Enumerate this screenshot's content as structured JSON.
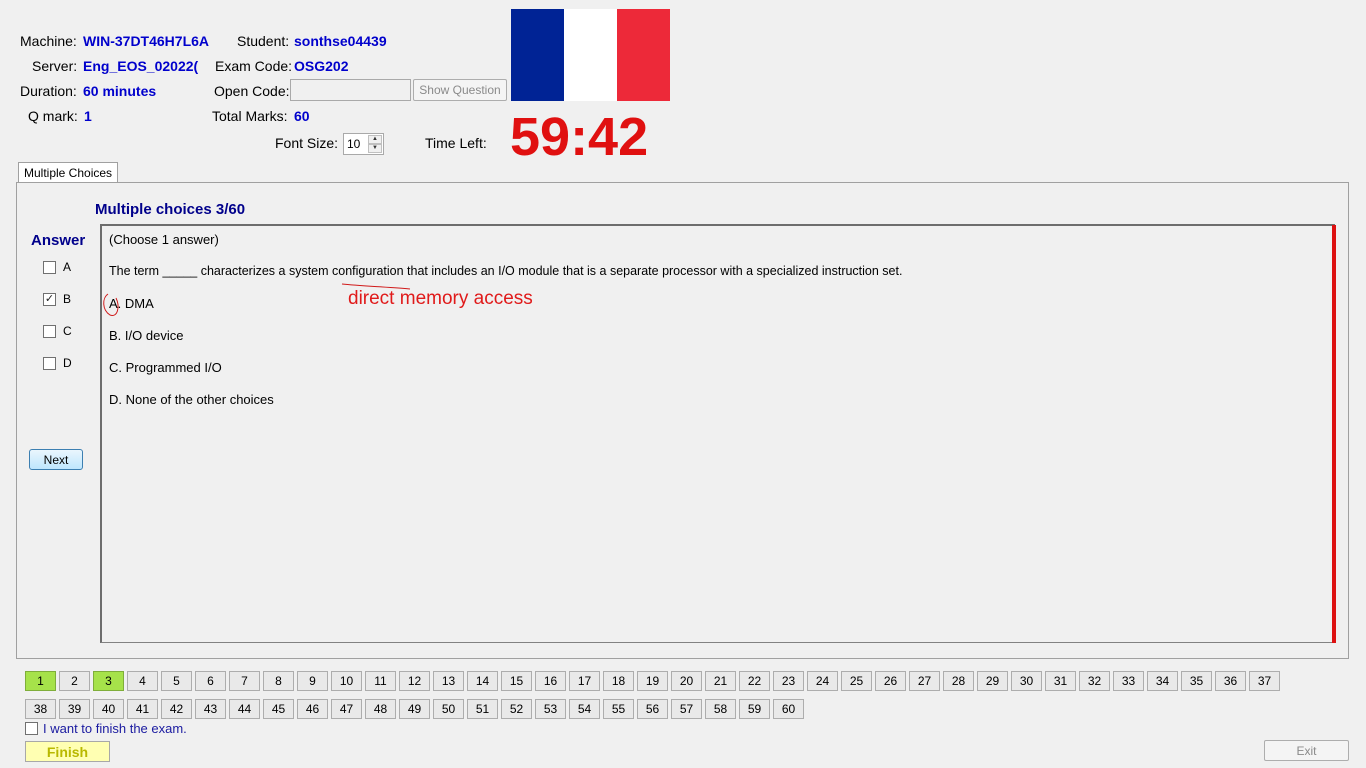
{
  "header": {
    "machine_label": "Machine:",
    "machine_value": "WIN-37DT46H7L6A",
    "student_label": "Student:",
    "student_value": "sonthse04439",
    "server_label": "Server:",
    "server_value": "Eng_EOS_02022(",
    "exam_code_label": "Exam Code:",
    "exam_code_value": "OSG202",
    "duration_label": "Duration:",
    "duration_value": "60 minutes",
    "open_code_label": "Open Code:",
    "open_code_value": "",
    "show_question_label": "Show Question",
    "qmark_label": "Q mark:",
    "qmark_value": "1",
    "total_marks_label": "Total Marks:",
    "total_marks_value": "60",
    "font_size_label": "Font Size:",
    "font_size_value": "10",
    "time_left_label": "Time Left:",
    "time_left_value": "59:42",
    "flag_colors": [
      "#002395",
      "#ffffff",
      "#ed2939"
    ]
  },
  "tabs": [
    {
      "label": "Multiple Choices",
      "active": true
    }
  ],
  "question": {
    "section_title": "Multiple choices 3/60",
    "answer_title": "Answer",
    "instruction": "(Choose 1 answer)",
    "text": "The term _____ characterizes a system configuration that includes an I/O module that is a separate processor with a specialized instruction set.",
    "options": [
      {
        "letter": "A.",
        "text": "DMA"
      },
      {
        "letter": "B.",
        "text": "I/O device"
      },
      {
        "letter": "C.",
        "text": "Programmed I/O"
      },
      {
        "letter": "D.",
        "text": "None of the other choices"
      }
    ],
    "annotation": "direct memory access"
  },
  "answers": [
    {
      "label": "A",
      "checked": false
    },
    {
      "label": "B",
      "checked": true
    },
    {
      "label": "C",
      "checked": false
    },
    {
      "label": "D",
      "checked": false
    }
  ],
  "next_label": "Next",
  "navigation": {
    "row1": [
      "1",
      "2",
      "3",
      "4",
      "5",
      "6",
      "7",
      "8",
      "9",
      "10",
      "11",
      "12",
      "13",
      "14",
      "15",
      "16",
      "17",
      "18",
      "19",
      "20",
      "21",
      "22",
      "23",
      "24",
      "25",
      "26",
      "27",
      "28",
      "29",
      "30",
      "31",
      "32",
      "33",
      "34",
      "35",
      "36",
      "37"
    ],
    "row2": [
      "38",
      "39",
      "40",
      "41",
      "42",
      "43",
      "44",
      "45",
      "46",
      "47",
      "48",
      "49",
      "50",
      "51",
      "52",
      "53",
      "54",
      "55",
      "56",
      "57",
      "58",
      "59",
      "60"
    ],
    "answered": [
      "1",
      "3"
    ]
  },
  "footer": {
    "finish_checkbox_label": "I want to finish the exam.",
    "finish_label": "Finish",
    "exit_label": "Exit"
  }
}
